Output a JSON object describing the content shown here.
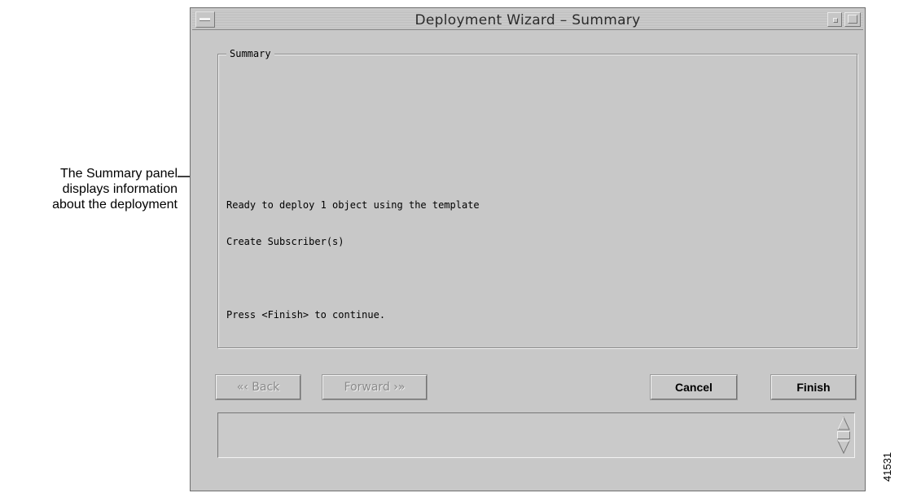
{
  "callout": {
    "lines": [
      "The Summary panel",
      "displays information",
      "about the deployment"
    ]
  },
  "window": {
    "title": "Deployment Wizard – Summary"
  },
  "summary": {
    "group_label": "Summary",
    "lines": [
      "Ready to deploy 1 object using the template",
      "Create Subscriber(s)",
      "",
      "Press <Finish> to continue."
    ]
  },
  "buttons": {
    "back": "«‹ Back",
    "forward": "Forward ›»",
    "cancel": "Cancel",
    "finish": "Finish"
  },
  "figure_id": "41531",
  "icons": {
    "window_menu": "window-menu-icon",
    "minimize": "minimize-icon",
    "maximize": "maximize-icon",
    "scroll_up": "scroll-up-arrow-icon",
    "scroll_down": "scroll-down-arrow-icon"
  }
}
